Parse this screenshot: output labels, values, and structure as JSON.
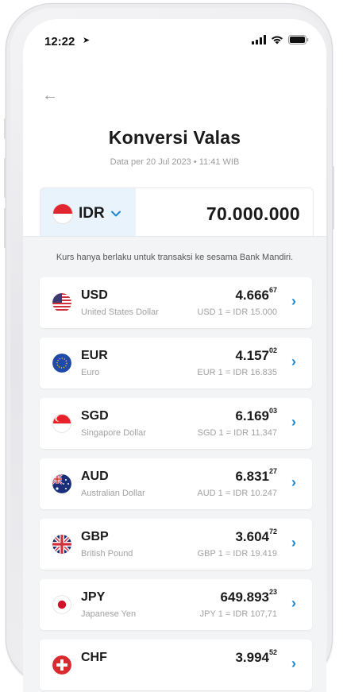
{
  "status_bar": {
    "time": "12:22",
    "location_glyph": "➤"
  },
  "header": {
    "title": "Konversi Valas",
    "subtitle": "Data per 20 Jul 2023 • 11:41 WIB"
  },
  "converter": {
    "currency": "IDR",
    "amount": "70.000.000"
  },
  "note": "Kurs hanya berlaku untuk transaksi ke sesama Bank Mandiri.",
  "rates": [
    {
      "code": "USD",
      "name": "United States Dollar",
      "value": "4.666",
      "decimal": "67",
      "conversion": "USD 1 = IDR 15.000",
      "flag": "us-flag-icon"
    },
    {
      "code": "EUR",
      "name": "Euro",
      "value": "4.157",
      "decimal": "02",
      "conversion": "EUR 1 = IDR 16.835",
      "flag": "eu-flag-icon"
    },
    {
      "code": "SGD",
      "name": "Singapore Dollar",
      "value": "6.169",
      "decimal": "03",
      "conversion": "SGD 1 = IDR 11.347",
      "flag": "sg-flag-icon"
    },
    {
      "code": "AUD",
      "name": "Australian Dollar",
      "value": "6.831",
      "decimal": "27",
      "conversion": "AUD 1 = IDR 10.247",
      "flag": "au-flag-icon"
    },
    {
      "code": "GBP",
      "name": "British Pound",
      "value": "3.604",
      "decimal": "72",
      "conversion": "GBP 1 = IDR 19.419",
      "flag": "gb-flag-icon"
    },
    {
      "code": "JPY",
      "name": "Japanese Yen",
      "value": "649.893",
      "decimal": "23",
      "conversion": "JPY 1 = IDR 107,71",
      "flag": "jp-flag-icon"
    },
    {
      "code": "CHF",
      "name": "",
      "value": "3.994",
      "decimal": "52",
      "conversion": "",
      "flag": "ch-flag-icon"
    }
  ],
  "colors": {
    "accent": "#1b86d6",
    "idr_select_bg": "#e9f3fb",
    "list_bg": "#f3f4f6"
  }
}
